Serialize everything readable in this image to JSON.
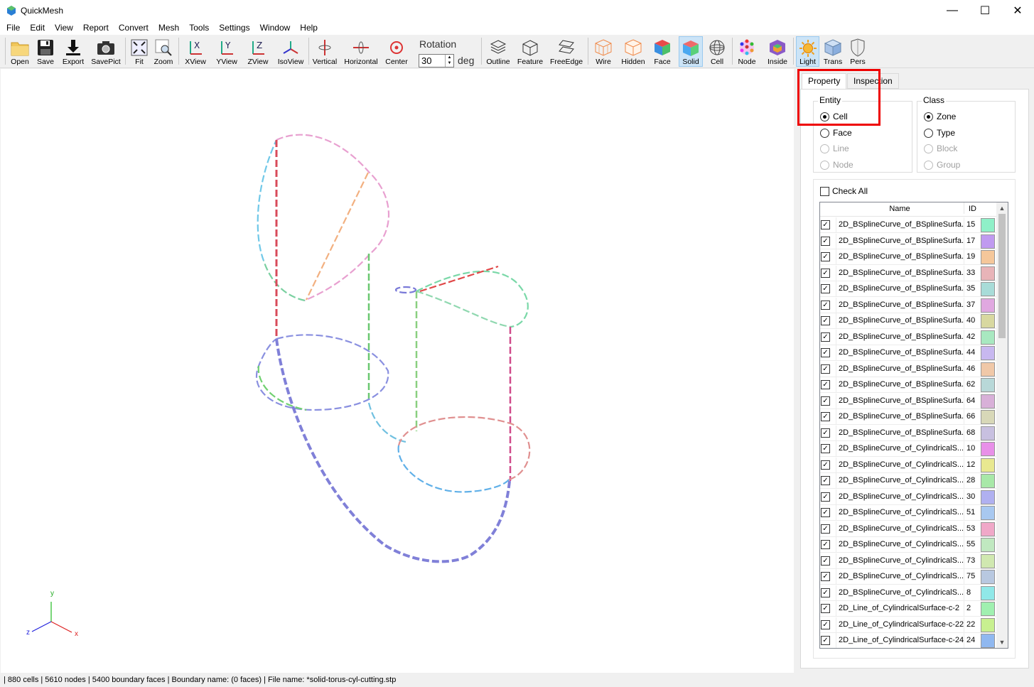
{
  "window": {
    "title": "QuickMesh",
    "controls": {
      "minimize": "—",
      "maximize": "☐",
      "close": "✕"
    }
  },
  "menu": [
    "File",
    "Edit",
    "View",
    "Report",
    "Convert",
    "Mesh",
    "Tools",
    "Settings",
    "Window",
    "Help"
  ],
  "toolbar": {
    "buttons": [
      {
        "label": "Open",
        "icon": "folder-icon"
      },
      {
        "label": "Save",
        "icon": "floppy-icon"
      },
      {
        "label": "Export",
        "icon": "download-icon"
      },
      {
        "label": "SavePict",
        "icon": "camera-icon"
      },
      {
        "label": "Fit",
        "icon": "fit-icon"
      },
      {
        "label": "Zoom",
        "icon": "zoom-icon"
      },
      {
        "label": "XView",
        "icon": "xview-icon"
      },
      {
        "label": "YView",
        "icon": "yview-icon"
      },
      {
        "label": "ZView",
        "icon": "zview-icon"
      },
      {
        "label": "IsoView",
        "icon": "isoview-icon"
      },
      {
        "label": "Vertical",
        "icon": "vertical-rotate-icon"
      },
      {
        "label": "Horizontal",
        "icon": "horizontal-rotate-icon"
      },
      {
        "label": "Center",
        "icon": "center-icon"
      },
      {
        "label": "Outline",
        "icon": "outline-icon"
      },
      {
        "label": "Feature",
        "icon": "feature-icon"
      },
      {
        "label": "FreeEdge",
        "icon": "freeedge-icon"
      },
      {
        "label": "Wire",
        "icon": "wire-cube-icon"
      },
      {
        "label": "Hidden",
        "icon": "hidden-cube-icon"
      },
      {
        "label": "Face",
        "icon": "face-cube-icon"
      },
      {
        "label": "Solid",
        "icon": "solid-cube-icon",
        "active": true
      },
      {
        "label": "Cell",
        "icon": "cell-sphere-icon"
      },
      {
        "label": "Node",
        "icon": "node-icon"
      },
      {
        "label": "Inside",
        "icon": "inside-icon"
      },
      {
        "label": "Light",
        "icon": "light-sun-icon",
        "active": true
      },
      {
        "label": "Trans",
        "icon": "trans-cube-icon"
      },
      {
        "label": "Pers",
        "icon": "pers-shield-icon"
      }
    ],
    "rotation_label": "Rotation",
    "rotation_value": "30",
    "rotation_unit": "deg"
  },
  "panel": {
    "tabs": [
      "Property",
      "Inspection"
    ],
    "entity": {
      "title": "Entity",
      "options": [
        {
          "label": "Cell",
          "checked": true,
          "enabled": true
        },
        {
          "label": "Face",
          "checked": false,
          "enabled": true
        },
        {
          "label": "Line",
          "checked": false,
          "enabled": false
        },
        {
          "label": "Node",
          "checked": false,
          "enabled": false
        }
      ]
    },
    "class": {
      "title": "Class",
      "options": [
        {
          "label": "Zone",
          "checked": true,
          "enabled": true
        },
        {
          "label": "Type",
          "checked": false,
          "enabled": true
        },
        {
          "label": "Block",
          "checked": false,
          "enabled": false
        },
        {
          "label": "Group",
          "checked": false,
          "enabled": false
        }
      ]
    },
    "check_all": "Check All",
    "columns": {
      "name": "Name",
      "id": "ID"
    },
    "rows": [
      {
        "name": "2D_BSplineCurve_of_BSplineSurfa...",
        "id": "15",
        "color": "#8ff0c8"
      },
      {
        "name": "2D_BSplineCurve_of_BSplineSurfa...",
        "id": "17",
        "color": "#c09af0"
      },
      {
        "name": "2D_BSplineCurve_of_BSplineSurfa...",
        "id": "19",
        "color": "#f5c79a"
      },
      {
        "name": "2D_BSplineCurve_of_BSplineSurfa...",
        "id": "33",
        "color": "#e8b4b8"
      },
      {
        "name": "2D_BSplineCurve_of_BSplineSurfa...",
        "id": "35",
        "color": "#a8dcd8"
      },
      {
        "name": "2D_BSplineCurve_of_BSplineSurfa...",
        "id": "37",
        "color": "#e0a8e0"
      },
      {
        "name": "2D_BSplineCurve_of_BSplineSurfa...",
        "id": "40",
        "color": "#d8d8a0"
      },
      {
        "name": "2D_BSplineCurve_of_BSplineSurfa...",
        "id": "42",
        "color": "#a8e8c0"
      },
      {
        "name": "2D_BSplineCurve_of_BSplineSurfa...",
        "id": "44",
        "color": "#c8b8f0"
      },
      {
        "name": "2D_BSplineCurve_of_BSplineSurfa...",
        "id": "46",
        "color": "#f0c8a8"
      },
      {
        "name": "2D_BSplineCurve_of_BSplineSurfa...",
        "id": "62",
        "color": "#b8d8d8"
      },
      {
        "name": "2D_BSplineCurve_of_BSplineSurfa...",
        "id": "64",
        "color": "#d8b0d8"
      },
      {
        "name": "2D_BSplineCurve_of_BSplineSurfa...",
        "id": "66",
        "color": "#d8d8b8"
      },
      {
        "name": "2D_BSplineCurve_of_BSplineSurfa...",
        "id": "68",
        "color": "#c8c0e0"
      },
      {
        "name": "2D_BSplineCurve_of_CylindricalS...",
        "id": "10",
        "color": "#e890e8"
      },
      {
        "name": "2D_BSplineCurve_of_CylindricalS...",
        "id": "12",
        "color": "#e8e890"
      },
      {
        "name": "2D_BSplineCurve_of_CylindricalS...",
        "id": "28",
        "color": "#a8e8a8"
      },
      {
        "name": "2D_BSplineCurve_of_CylindricalS...",
        "id": "30",
        "color": "#b0b0f0"
      },
      {
        "name": "2D_BSplineCurve_of_CylindricalS...",
        "id": "51",
        "color": "#a8c8f0"
      },
      {
        "name": "2D_BSplineCurve_of_CylindricalS...",
        "id": "53",
        "color": "#f0a8c8"
      },
      {
        "name": "2D_BSplineCurve_of_CylindricalS...",
        "id": "55",
        "color": "#c0e8c0"
      },
      {
        "name": "2D_BSplineCurve_of_CylindricalS...",
        "id": "73",
        "color": "#d0e8b0"
      },
      {
        "name": "2D_BSplineCurve_of_CylindricalS...",
        "id": "75",
        "color": "#b8c8e0"
      },
      {
        "name": "2D_BSplineCurve_of_CylindricalS...",
        "id": "8",
        "color": "#90e8e8"
      },
      {
        "name": "2D_Line_of_CylindricalSurface-c-2",
        "id": "2",
        "color": "#a0f0b0"
      },
      {
        "name": "2D_Line_of_CylindricalSurface-c-22",
        "id": "22",
        "color": "#c8f090"
      },
      {
        "name": "2D_Line_of_CylindricalSurface-c-24",
        "id": "24",
        "color": "#90b8f0"
      }
    ]
  },
  "axes": {
    "x": "x",
    "y": "y",
    "z": "z"
  },
  "status": "| 880 cells | 5610 nodes | 5400 boundary faces |  Boundary name:  (0 faces) | File name: *solid-torus-cyl-cutting.stp"
}
